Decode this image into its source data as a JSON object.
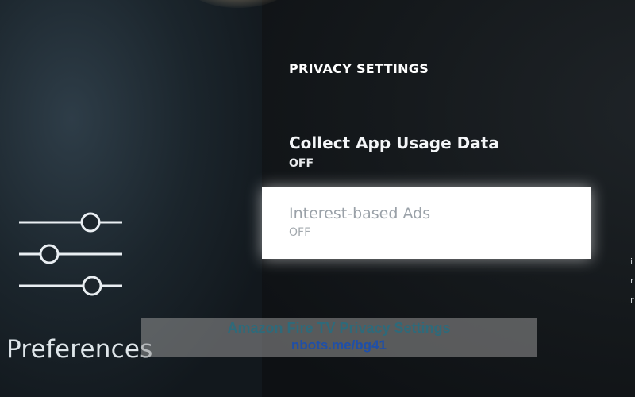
{
  "sidebar": {
    "icon": "sliders-icon",
    "label": "Preferences"
  },
  "privacy": {
    "section_title": "PRIVACY SETTINGS",
    "items": [
      {
        "name": "Collect App Usage Data",
        "value": "OFF",
        "selected": false
      },
      {
        "name": "Interest-based Ads",
        "value": "OFF",
        "selected": true
      }
    ]
  },
  "watermark": {
    "title": "Amazon Fire TV Privacy Settings",
    "url": "nbots.me/bg41"
  },
  "colors": {
    "background": "#0c0f12",
    "selected_row": "#ffffff",
    "text": "#f4f6f8"
  }
}
